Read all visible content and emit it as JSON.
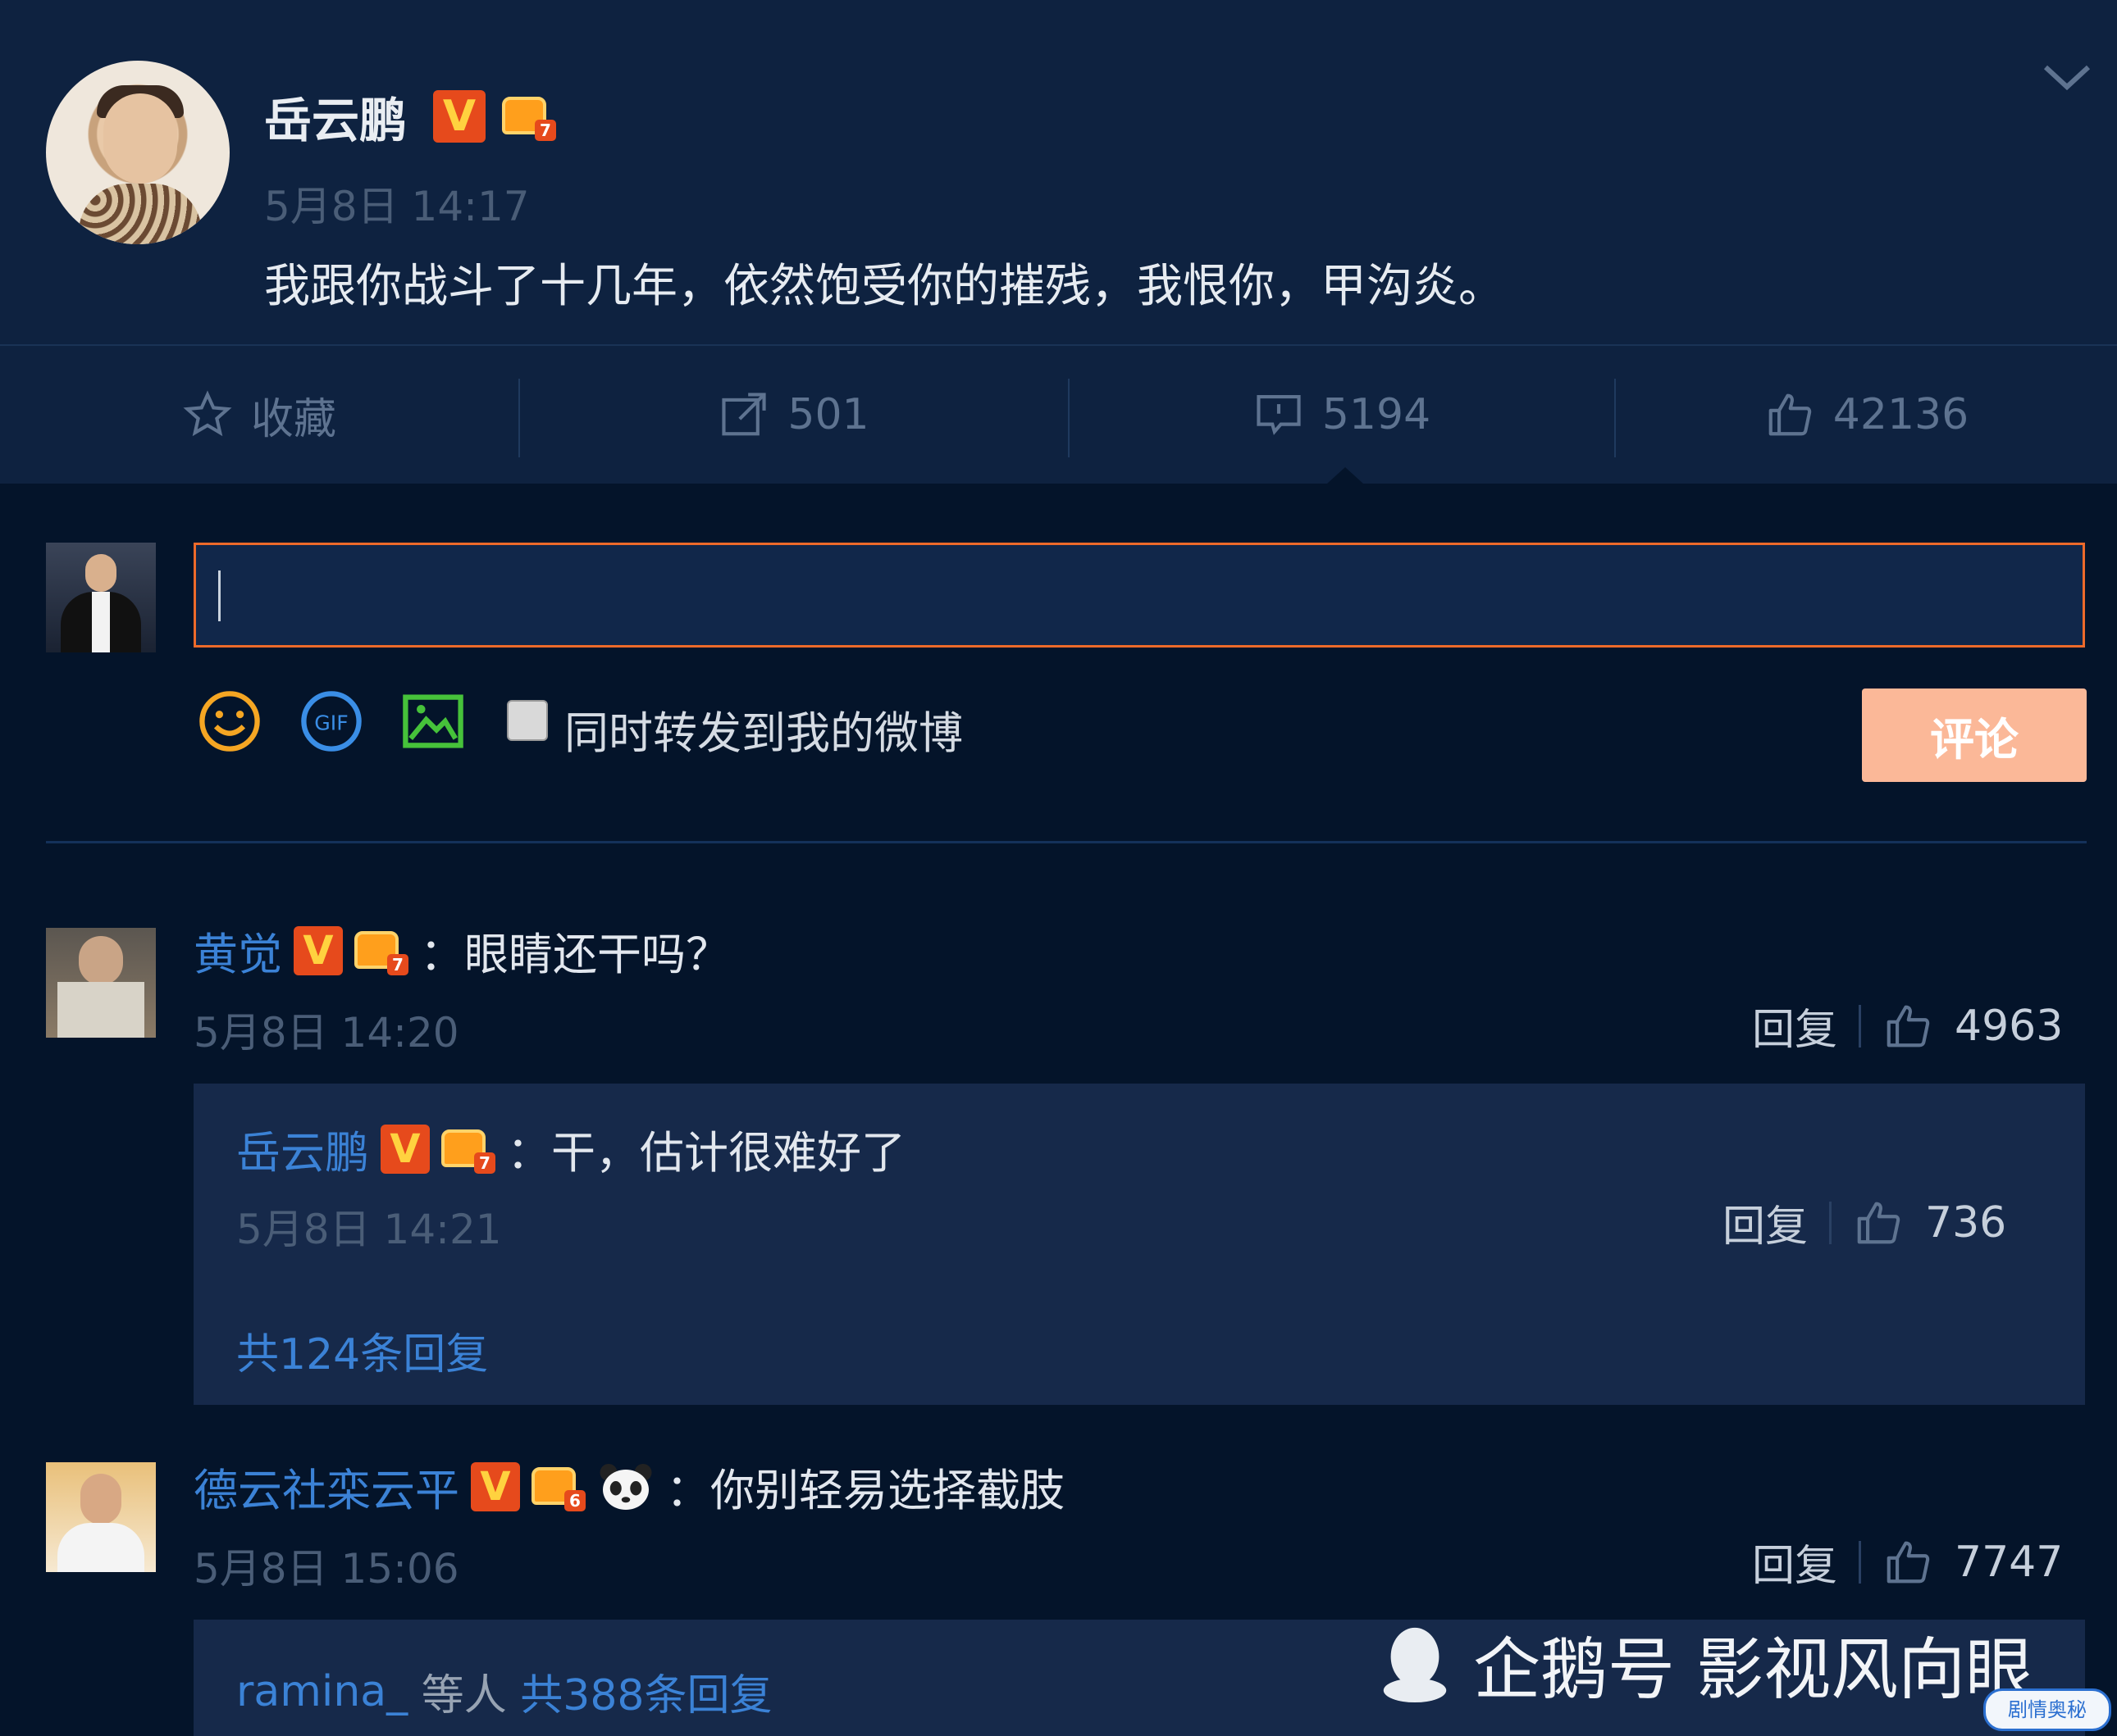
{
  "post": {
    "author": "岳云鹏",
    "author_level": "7",
    "timestamp": "5月8日 14:17",
    "text": "我跟你战斗了十几年，依然饱受你的摧残，我恨你，甲沟炎。"
  },
  "actions": {
    "favorite_label": "收藏",
    "repost_count": "501",
    "comment_count": "5194",
    "like_count": "42136"
  },
  "composer": {
    "input_value": "",
    "repost_checkbox_label": "同时转发到我的微博",
    "submit_label": "评论"
  },
  "comments": [
    {
      "author": "黄觉",
      "level": "7",
      "separator": "：",
      "text": "眼睛还干吗？",
      "timestamp": "5月8日 14:20",
      "reply_label": "回复",
      "likes": "4963",
      "reply": {
        "author": "岳云鹏",
        "level": "7",
        "separator": "：",
        "text": "干，估计很难好了",
        "timestamp": "5月8日 14:21",
        "reply_label": "回复",
        "likes": "736"
      },
      "more_replies": "共124条回复"
    },
    {
      "author": "德云社栾云平",
      "level": "6",
      "separator": "：",
      "text": "你别轻易选择截肢",
      "timestamp": "5月8日 15:06",
      "reply_label": "回复",
      "likes": "7747",
      "replies_user": "ramina_",
      "replies_mid": " 等人 ",
      "more_replies": "共388条回复"
    }
  ],
  "watermark": {
    "text": "企鹅号 影视风向眼",
    "badge": "剧情奥秘"
  },
  "colors": {
    "background": "#04142a",
    "header_bg": "#0e2240",
    "accent_orange": "#ee6a2a",
    "submit_bg": "#fbb898",
    "link_blue": "#3b82d6"
  }
}
